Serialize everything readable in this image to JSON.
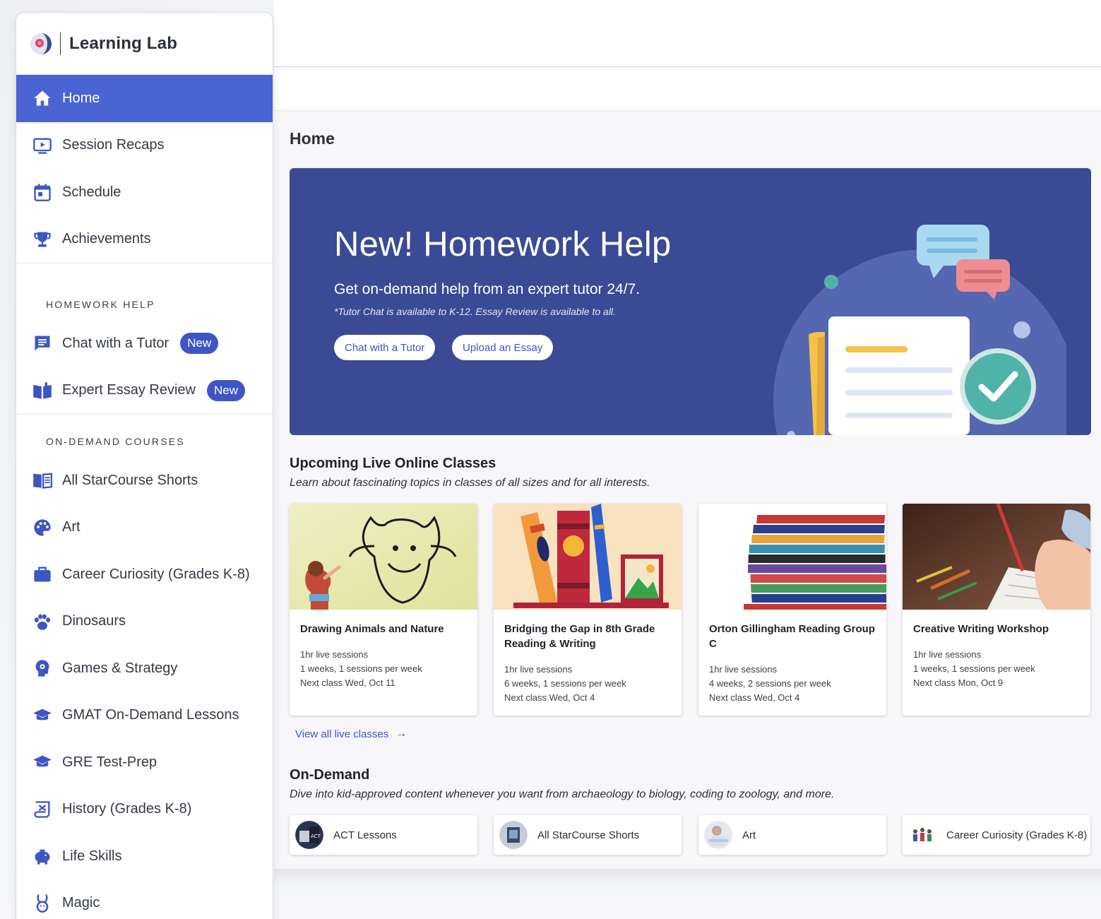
{
  "brand": {
    "name": "Learning Lab"
  },
  "nav": {
    "primary": [
      {
        "label": "Home",
        "icon": "home-icon",
        "active": true
      },
      {
        "label": "Session Recaps",
        "icon": "video-screen-icon"
      },
      {
        "label": "Schedule",
        "icon": "calendar-icon"
      },
      {
        "label": "Achievements",
        "icon": "trophy-icon"
      }
    ],
    "homework_header": "HOMEWORK HELP",
    "homework": [
      {
        "label": "Chat with a Tutor",
        "icon": "chat-icon",
        "badge": "New"
      },
      {
        "label": "Expert Essay Review",
        "icon": "open-book-icon",
        "badge": "New"
      }
    ],
    "courses_header": "ON-DEMAND COURSES",
    "courses": [
      {
        "label": "All StarCourse Shorts",
        "icon": "book-icon"
      },
      {
        "label": "Art",
        "icon": "palette-icon"
      },
      {
        "label": "Career Curiosity (Grades K-8)",
        "icon": "briefcase-icon"
      },
      {
        "label": "Dinosaurs",
        "icon": "paw-icon"
      },
      {
        "label": "Games & Strategy",
        "icon": "brain-icon"
      },
      {
        "label": "GMAT On-Demand Lessons",
        "icon": "graduation-cap-icon"
      },
      {
        "label": "GRE Test-Prep",
        "icon": "graduation-cap-icon"
      },
      {
        "label": "History (Grades K-8)",
        "icon": "scroll-icon"
      },
      {
        "label": "Life Skills",
        "icon": "piggy-bank-icon"
      },
      {
        "label": "Magic",
        "icon": "rabbit-icon"
      }
    ]
  },
  "page": {
    "title": "Home"
  },
  "hero": {
    "title": "New! Homework Help",
    "subtitle": "Get on-demand help from an expert tutor 24/7.",
    "note": "*Tutor Chat is available to K-12. Essay Review is available to all.",
    "buttons": [
      "Chat with a Tutor",
      "Upload an Essay"
    ]
  },
  "live": {
    "title": "Upcoming Live Online Classes",
    "description": "Learn about fascinating topics in classes of all sizes and for all interests.",
    "cards": [
      {
        "title": "Drawing Animals and Nature",
        "lines": [
          "1hr live sessions",
          "1 weeks, 1 sessions per week",
          "Next class Wed, Oct 11"
        ]
      },
      {
        "title": "Bridging the Gap in 8th Grade Reading & Writing",
        "lines": [
          "1hr live sessions",
          "6 weeks, 1 sessions per week",
          "Next class Wed, Oct 4"
        ]
      },
      {
        "title": "Orton Gillingham Reading Group C",
        "lines": [
          "1hr live sessions",
          "4 weeks, 2 sessions per week",
          "Next class Wed, Oct 4"
        ]
      },
      {
        "title": "Creative Writing Workshop",
        "lines": [
          "1hr live sessions",
          "1 weeks, 1 sessions per week",
          "Next class Mon, Oct 9"
        ]
      }
    ],
    "view_all": "View all live classes"
  },
  "ondemand": {
    "title": "On-Demand",
    "description": "Dive into kid-approved content whenever you want from archaeology to biology, coding to zoology, and more.",
    "cards": [
      {
        "label": "ACT Lessons"
      },
      {
        "label": "All StarCourse Shorts"
      },
      {
        "label": "Art"
      },
      {
        "label": "Career Curiosity (Grades K-8)"
      }
    ]
  },
  "colors": {
    "accent": "#4a64d3",
    "hero_bg": "#3b4a95",
    "badge": "#3e56c4",
    "icon": "#3e56c4"
  }
}
